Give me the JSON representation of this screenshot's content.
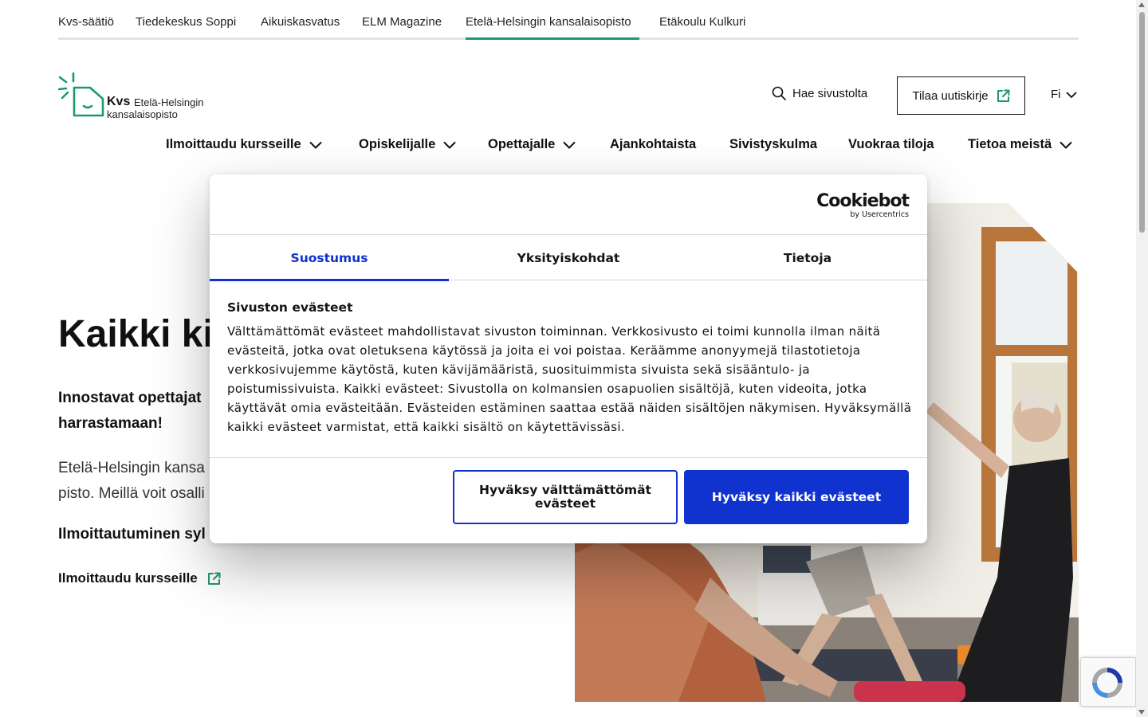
{
  "top_links": [
    {
      "label": "Kvs-säätiö",
      "active": false
    },
    {
      "label": "Tiedekeskus Soppi",
      "active": false
    },
    {
      "label": "Aikuiskasvatus",
      "active": false
    },
    {
      "label": "ELM Magazine",
      "active": false
    },
    {
      "label": "Etelä-Helsingin kansalaisopisto",
      "active": true
    },
    {
      "label": "Etäkoulu Kulkuri",
      "active": false
    }
  ],
  "logo": {
    "abbr": "Kvs",
    "line1": "Etelä-Helsingin",
    "line2": "kansalaisopisto",
    "color": "#1d9a6c"
  },
  "header": {
    "search_label": "Hae sivustolta",
    "newsletter_label": "Tilaa uutiskirje",
    "language": "Fi"
  },
  "main_nav": [
    {
      "label": "Ilmoittaudu kursseille",
      "has_dropdown": true
    },
    {
      "label": "Opiskelijalle",
      "has_dropdown": true
    },
    {
      "label": "Opettajalle",
      "has_dropdown": true
    },
    {
      "label": "Ajankohtaista",
      "has_dropdown": false
    },
    {
      "label": "Sivistyskulma",
      "has_dropdown": false
    },
    {
      "label": "Vuokraa tiloja",
      "has_dropdown": false
    },
    {
      "label": "Tietoa meistä",
      "has_dropdown": true
    }
  ],
  "hero": {
    "title": "Kaikki kiv",
    "lead": "Innostavat opettajat\nharrastamaan!",
    "body": "Etelä-Helsingin kansa\npisto. Meillä voit osalli",
    "subheading": "Ilmoittautuminen syl",
    "link_label": "Ilmoittaudu kursseille"
  },
  "cookie_dialog": {
    "brand": "Cookiebot",
    "brand_sub": "by Usercentrics",
    "tabs": [
      {
        "label": "Suostumus",
        "active": true
      },
      {
        "label": "Yksityiskohdat",
        "active": false
      },
      {
        "label": "Tietoja",
        "active": false
      }
    ],
    "heading": "Sivuston evästeet",
    "text": "Välttämättömät evästeet mahdollistavat sivuston toiminnan. Verkkosivusto ei toimi kunnolla ilman näitä evästeitä, jotka ovat oletuksena käytössä ja joita ei voi poistaa. Keräämme anonyymejä tilastotietoja verkkosivujemme käytöstä, kuten kävijämääristä, suosituimmista sivuista sekä sisääntulo- ja poistumissivuista. Kaikki evästeet: Sivustolla on kolmansien osapuolien sisältöjä, kuten videoita, jotka käyttävät omia evästeitään. Evästeiden estäminen saattaa estää näiden sisältöjen näkymisen. Hyväksymällä kaikki evästeet varmistat, että kaikki sisältö on käytettävissäsi.",
    "btn_necessary": "Hyväksy välttämättömät evästeet",
    "btn_all": "Hyväksy kaikki evästeet",
    "accent_color": "#1032cf"
  }
}
